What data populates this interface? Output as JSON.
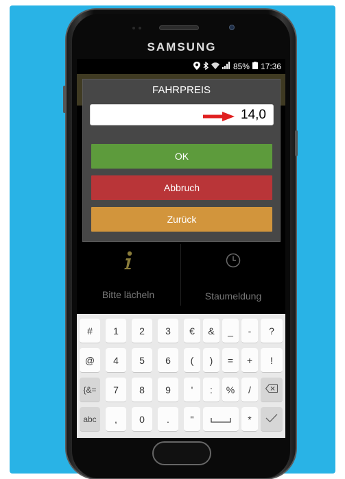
{
  "device": {
    "brand": "SAMSUNG"
  },
  "status_bar": {
    "icons": [
      "location-icon",
      "bluetooth-icon",
      "wifi-icon",
      "signal-icon"
    ],
    "battery": "85%",
    "time": "17:36"
  },
  "background_app": {
    "tiles": [
      {
        "label": "Bitte lächeln",
        "icon": "info-icon"
      },
      {
        "label": "Staumeldung",
        "icon": "clock-icon"
      }
    ]
  },
  "dialog": {
    "title": "FAHRPREIS",
    "input_value": "14,0",
    "buttons": {
      "ok": "OK",
      "cancel": "Abbruch",
      "back": "Zurück"
    }
  },
  "keyboard": {
    "rows": [
      [
        "#",
        "1",
        "2",
        "3",
        "€",
        "&",
        "_",
        "-",
        "?"
      ],
      [
        "@",
        "4",
        "5",
        "6",
        "(",
        ")",
        "=",
        "+",
        "!"
      ],
      [
        "{&=",
        "7",
        "8",
        "9",
        "'",
        ":",
        "%",
        "/",
        "⌫"
      ],
      [
        "abc",
        ",",
        "0",
        ".",
        "\"",
        "␣",
        "*",
        "✓"
      ]
    ]
  },
  "colors": {
    "frame": "#29b3e6",
    "ok": "#5d9b3c",
    "cancel": "#b93538",
    "back": "#d2953c",
    "arrow": "#e02020"
  }
}
